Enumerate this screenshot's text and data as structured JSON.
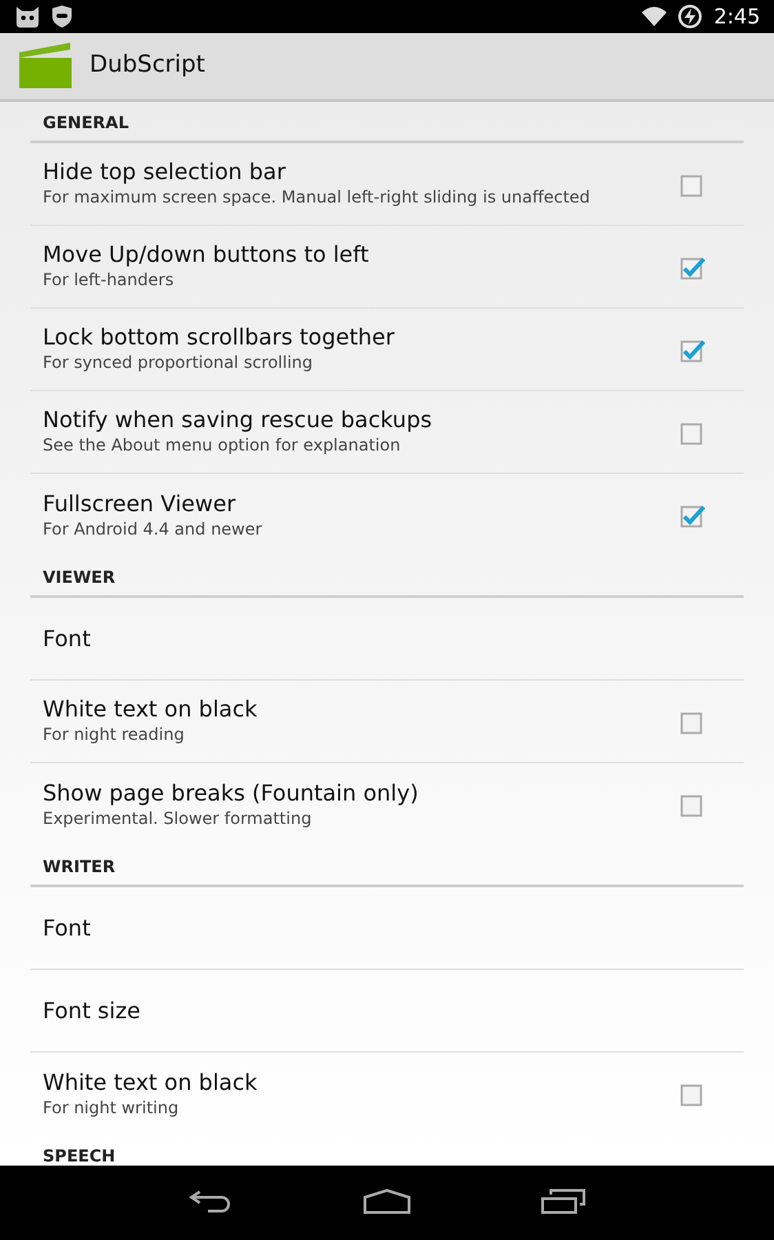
{
  "status_bar": {
    "time": "2:45"
  },
  "action_bar": {
    "title": "DubScript"
  },
  "sections": [
    {
      "header": "GENERAL",
      "items": [
        {
          "kind": "checkbox",
          "title": "Hide top selection bar",
          "subtitle": "For maximum screen space.  Manual left-right sliding is unaffected",
          "checked": false
        },
        {
          "kind": "checkbox",
          "title": "Move Up/down buttons to left",
          "subtitle": "For left-handers",
          "checked": true
        },
        {
          "kind": "checkbox",
          "title": "Lock bottom scrollbars together",
          "subtitle": "For synced proportional scrolling",
          "checked": true
        },
        {
          "kind": "checkbox",
          "title": "Notify when saving rescue backups",
          "subtitle": "See the About menu option for explanation",
          "checked": false
        },
        {
          "kind": "checkbox",
          "title": "Fullscreen Viewer",
          "subtitle": "For Android 4.4 and newer",
          "checked": true
        }
      ]
    },
    {
      "header": "VIEWER",
      "items": [
        {
          "kind": "plain",
          "title": "Font"
        },
        {
          "kind": "checkbox",
          "title": "White text on black",
          "subtitle": "For night reading",
          "checked": false
        },
        {
          "kind": "checkbox",
          "title": "Show page breaks (Fountain only)",
          "subtitle": "Experimental.  Slower formatting",
          "checked": false
        }
      ]
    },
    {
      "header": "WRITER",
      "items": [
        {
          "kind": "plain",
          "title": "Font"
        },
        {
          "kind": "plain",
          "title": "Font size"
        },
        {
          "kind": "checkbox",
          "title": "White text on black",
          "subtitle": "For night writing",
          "checked": false
        }
      ]
    },
    {
      "header": "SPEECH"
    }
  ]
}
